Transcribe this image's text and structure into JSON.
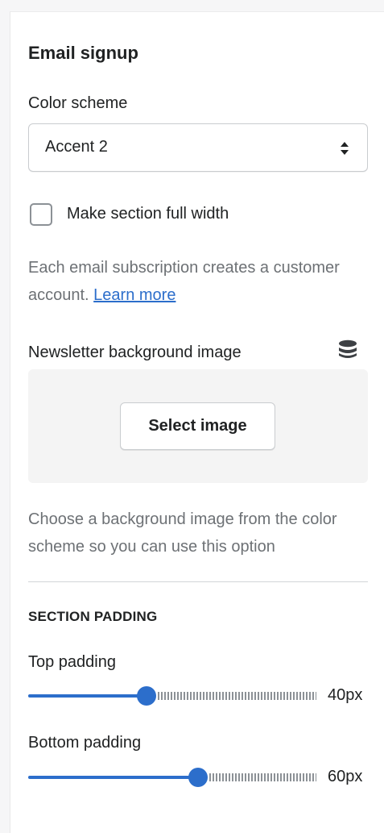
{
  "section": {
    "title": "Email signup"
  },
  "color_scheme": {
    "label": "Color scheme",
    "value": "Accent 2"
  },
  "full_width": {
    "label": "Make section full width",
    "checked": false
  },
  "subscription_help": {
    "text": "Each email subscription creates a customer account.",
    "link": "Learn more"
  },
  "newsletter_image": {
    "label": "Newsletter background image",
    "button": "Select image",
    "icon": "database-icon",
    "help": "Choose a background image from the color scheme so you can use this option"
  },
  "padding": {
    "heading": "SECTION PADDING",
    "top": {
      "label": "Top padding",
      "value_text": "40px",
      "fraction": 0.41
    },
    "bottom": {
      "label": "Bottom padding",
      "value_text": "60px",
      "fraction": 0.59
    }
  },
  "colors": {
    "accent": "#2c6ecb",
    "text": "#202223",
    "subdued": "#6d7175"
  }
}
